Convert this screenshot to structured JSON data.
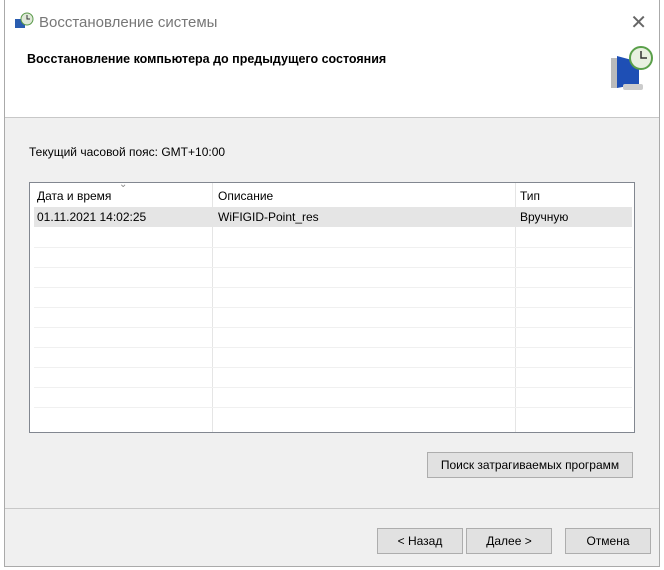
{
  "window": {
    "title": "Восстановление системы",
    "close_icon": "close-icon"
  },
  "header": {
    "title": "Восстановление компьютера до предыдущего состояния",
    "icon": "system-restore-icon"
  },
  "timezone": "Текущий часовой пояс: GMT+10:00",
  "table": {
    "columns": [
      "Дата и время",
      "Описание",
      "Тип"
    ],
    "sorted_column": "Дата и время",
    "rows": [
      {
        "date": "01.11.2021 14:02:25",
        "description": "WiFIGID-Point_res",
        "type": "Вручную",
        "selected": true
      }
    ]
  },
  "buttons": {
    "scan": "Поиск затрагиваемых программ",
    "back": "< Назад",
    "next": "Далее >",
    "cancel": "Отмена"
  }
}
